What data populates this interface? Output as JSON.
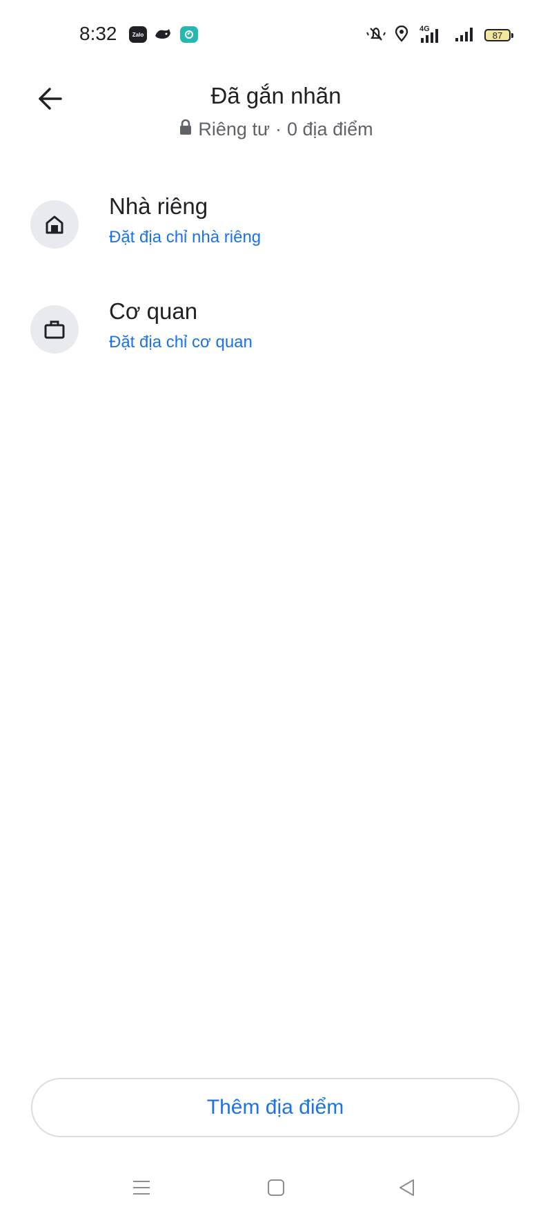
{
  "status_bar": {
    "time": "8:32",
    "app_icons": [
      "zalo-icon",
      "messenger-whale-icon",
      "teal-app-icon"
    ],
    "network_label": "4G",
    "battery": "87"
  },
  "header": {
    "title": "Đã gắn nhãn",
    "privacy": "Riêng tư",
    "separator": "·",
    "count_text": "0 địa điểm"
  },
  "items": [
    {
      "icon": "home-icon",
      "title": "Nhà riêng",
      "subtitle": "Đặt địa chỉ nhà riêng"
    },
    {
      "icon": "briefcase-icon",
      "title": "Cơ quan",
      "subtitle": "Đặt địa chỉ cơ quan"
    }
  ],
  "add_button": {
    "label": "Thêm địa điểm"
  },
  "colors": {
    "accent": "#1a73e8",
    "text_primary": "#202124",
    "text_secondary": "#5f6368",
    "icon_bg": "#e8eaed",
    "border": "#dadce0"
  }
}
